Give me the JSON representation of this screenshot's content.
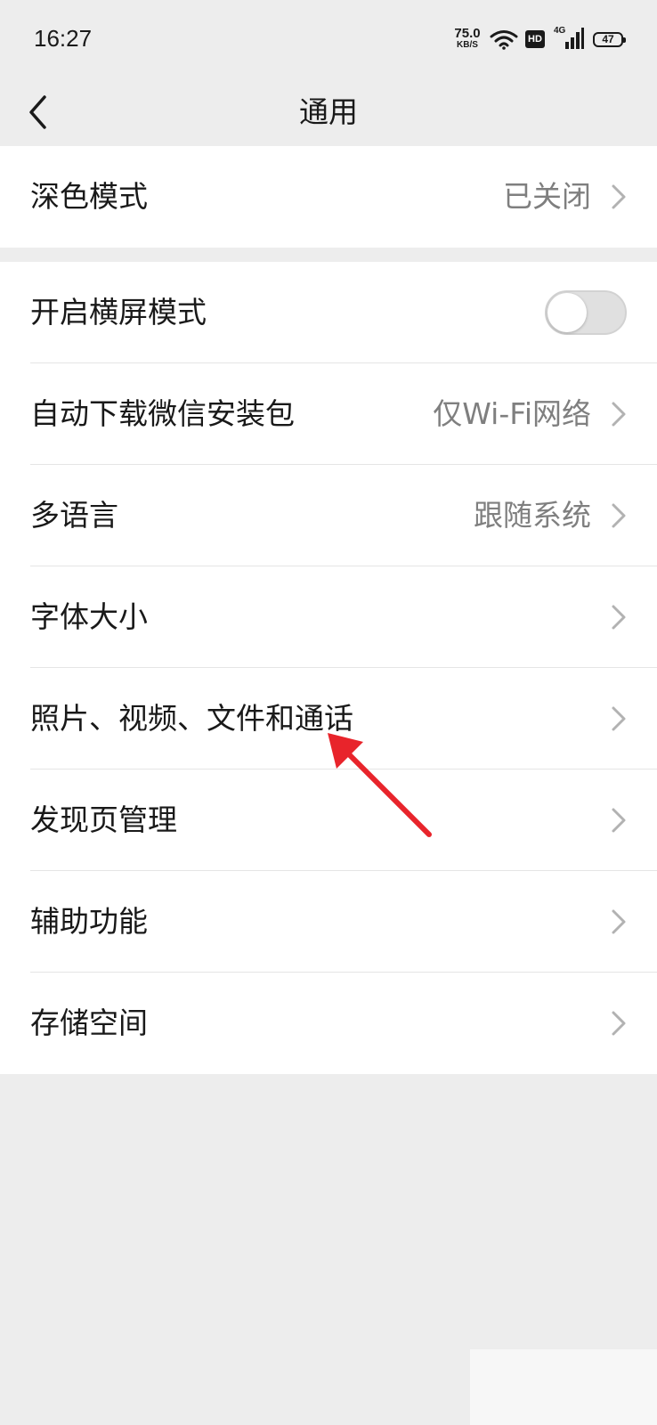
{
  "status_bar": {
    "time": "16:27",
    "net_speed_value": "75.0",
    "net_speed_unit": "KB/S",
    "hd_label": "HD",
    "network_label": "4G",
    "battery_level": "47"
  },
  "header": {
    "title": "通用"
  },
  "group1": [
    {
      "label": "深色模式",
      "value": "已关闭"
    }
  ],
  "group2": {
    "landscape": {
      "label": "开启横屏模式",
      "toggle_on": false
    },
    "items": [
      {
        "label": "自动下载微信安装包",
        "value": "仅Wi-Fi网络"
      },
      {
        "label": "多语言",
        "value": "跟随系统"
      },
      {
        "label": "字体大小",
        "value": ""
      },
      {
        "label": "照片、视频、文件和通话",
        "value": ""
      },
      {
        "label": "发现页管理",
        "value": ""
      },
      {
        "label": "辅助功能",
        "value": ""
      },
      {
        "label": "存储空间",
        "value": ""
      }
    ]
  },
  "colors": {
    "background": "#ededed",
    "card": "#ffffff",
    "value_text": "#7f7f7f",
    "annotation_arrow": "#e8242b"
  },
  "icons": {
    "back": "chevron-left-icon",
    "row_arrow": "chevron-right-icon",
    "annotation": "red-arrow-icon"
  }
}
